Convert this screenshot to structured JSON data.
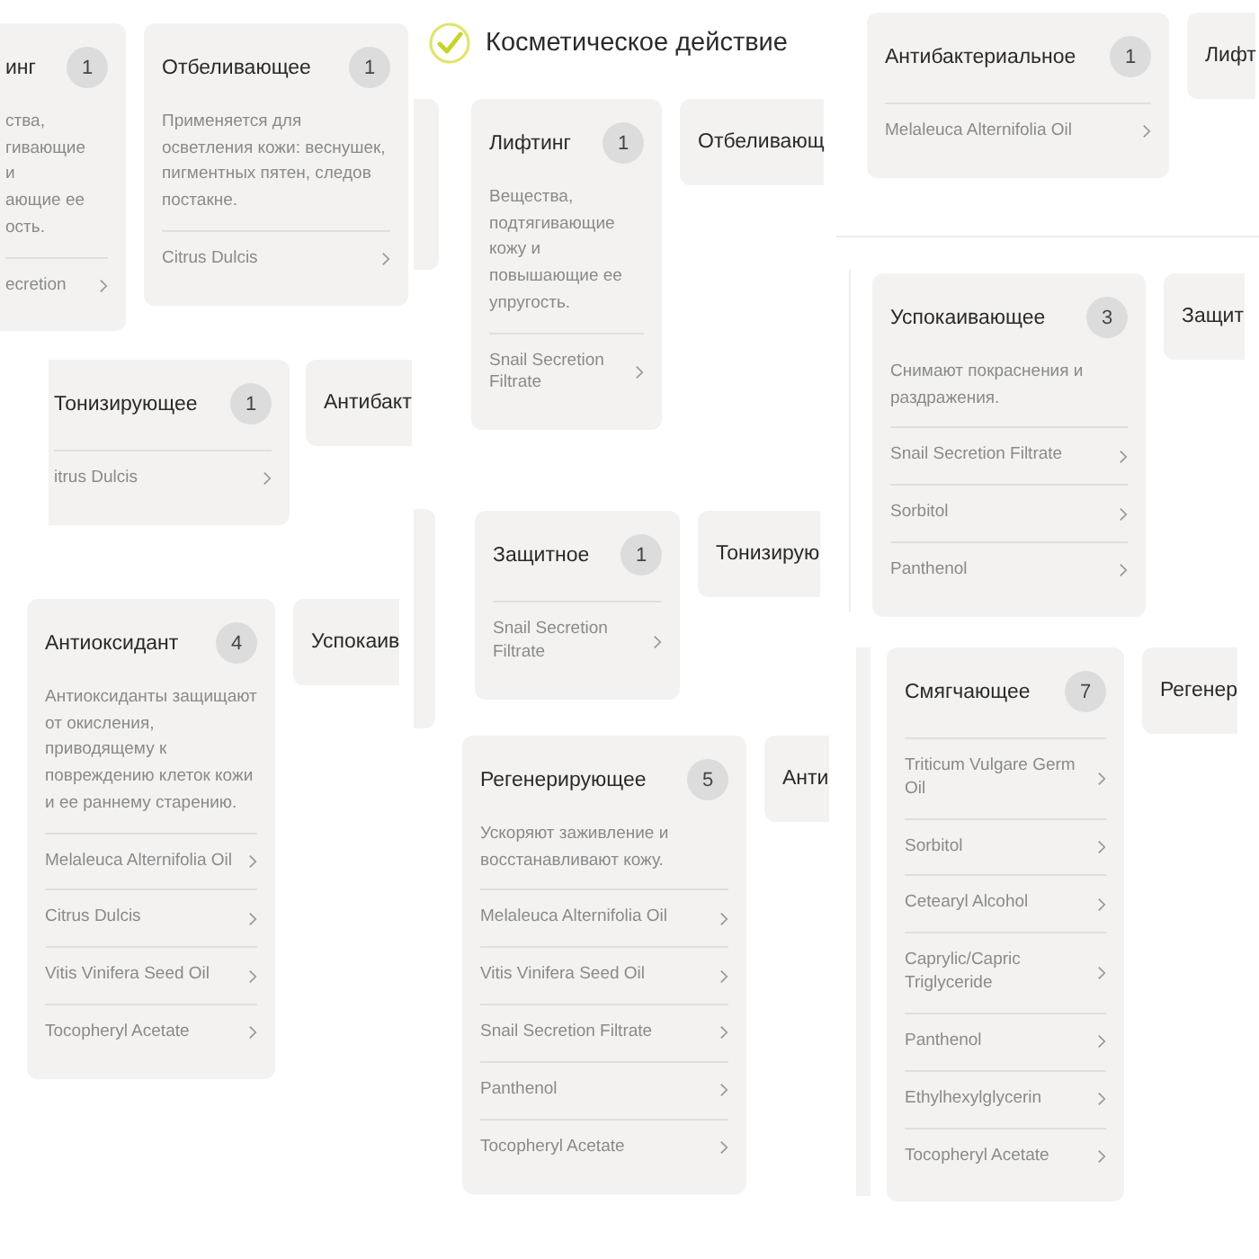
{
  "heading": {
    "title": "Косметическое действие"
  },
  "cards": [
    {
      "title": "инг",
      "count": "1",
      "description": "ства,\nгивающие\nи\nающие ее\nость.",
      "items": [
        "ecretion"
      ]
    },
    {
      "title": "Отбеливающее",
      "count": "1",
      "description": "Применяется для осветления кожи: веснушек, пигментных пятен, следов постакне.",
      "items": [
        "Citrus Dulcis"
      ]
    },
    {
      "title": "Тонизирующее",
      "count": "1",
      "items": [
        "itrus Dulcis"
      ]
    },
    {
      "title": "Антибакт"
    },
    {
      "title": "Лифтинг",
      "count": "1",
      "description": "Вещества, подтягивающие кожу и повышающие ее упругость.",
      "items": [
        "Snail Secretion Filtrate"
      ]
    },
    {
      "title": "Отбеливающ"
    },
    {
      "title": "Антибактериальное",
      "count": "1",
      "items": [
        "Melaleuca Alternifolia Oil"
      ]
    },
    {
      "title": "Лифт"
    },
    {
      "title": "Успокаивающее",
      "count": "3",
      "description": "Снимают покраснения и раздражения.",
      "items": [
        "Snail Secretion Filtrate",
        "Sorbitol",
        "Panthenol"
      ]
    },
    {
      "title": "Защит"
    },
    {
      "title": "Антиоксидант",
      "count": "4",
      "description": "Антиоксиданты защищают от окисления, приводящему к повреждению клеток кожи и ее раннему старению.",
      "items": [
        "Melaleuca Alternifolia Oil",
        "Citrus Dulcis",
        "Vitis Vinifera Seed Oil",
        "Tocopheryl Acetate"
      ]
    },
    {
      "title": "Успокаив"
    },
    {
      "title": "Защитное",
      "count": "1",
      "items": [
        "Snail Secretion Filtrate"
      ]
    },
    {
      "title": "Тонизирую"
    },
    {
      "title": "Регенерирующее",
      "count": "5",
      "description": "Ускоряют заживление и восстанавливают кожу.",
      "items": [
        "Melaleuca Alternifolia Oil",
        "Vitis Vinifera Seed Oil",
        "Snail Secretion Filtrate",
        "Panthenol",
        "Tocopheryl Acetate"
      ]
    },
    {
      "title": "Анти"
    },
    {
      "title": "Смягчающее",
      "count": "7",
      "items": [
        "Triticum Vulgare Germ Oil",
        "Sorbitol",
        "Cetearyl Alcohol",
        "Caprylic/Capric Triglyceride",
        "Panthenol",
        "Ethylhexylglycerin",
        "Tocopheryl Acetate"
      ]
    },
    {
      "title": "Регенер"
    }
  ]
}
